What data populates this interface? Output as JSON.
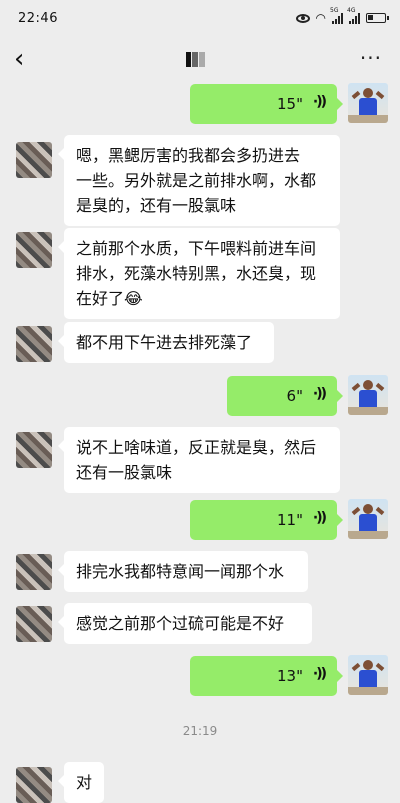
{
  "status_bar": {
    "time": "22:46",
    "signal_1_label": "5G",
    "signal_2_label": "4G"
  },
  "header": {
    "back_icon": "chevron-left-icon",
    "title": "",
    "more_label": "···"
  },
  "messages": [
    {
      "side": "right",
      "type": "voice",
      "duration": "15\""
    },
    {
      "side": "left",
      "type": "text",
      "lines": [
        "嗯，黑鳃厉害的我都会多扔进去",
        "一些。另外就是之前排水啊，水都",
        "是臭的，还有一股氯味"
      ]
    },
    {
      "side": "left",
      "type": "text",
      "lines": [
        "之前那个水质，下午喂料前进车间",
        "排水，死藻水特别黑，水还臭，现",
        "在好了😂"
      ]
    },
    {
      "side": "left",
      "type": "text",
      "lines": [
        "都不用下午进去排死藻了"
      ]
    },
    {
      "side": "right",
      "type": "voice",
      "duration": "6\""
    },
    {
      "side": "left",
      "type": "text",
      "lines": [
        "说不上啥味道，反正就是臭，然后",
        "还有一股氯味"
      ]
    },
    {
      "side": "right",
      "type": "voice",
      "duration": "11\""
    },
    {
      "side": "left",
      "type": "text",
      "lines": [
        "排完水我都特意闻一闻那个水"
      ]
    },
    {
      "side": "left",
      "type": "text",
      "lines": [
        "感觉之前那个过硫可能是不好"
      ]
    },
    {
      "side": "right",
      "type": "voice",
      "duration": "13\""
    },
    {
      "type": "timestamp",
      "text": "21:19"
    },
    {
      "side": "left",
      "type": "text",
      "lines": [
        "对"
      ]
    }
  ],
  "colors": {
    "background": "#ededed",
    "outgoing_bubble": "#95ec69",
    "incoming_bubble": "#ffffff"
  }
}
